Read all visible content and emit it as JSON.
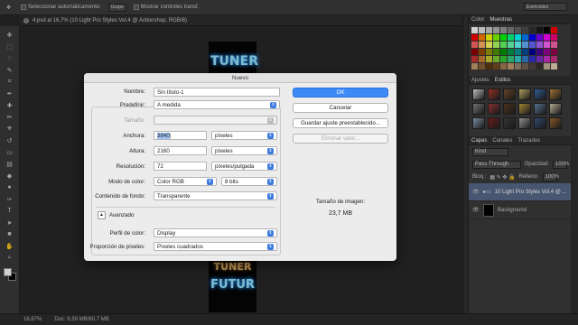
{
  "options_bar": {
    "auto_select_label": "Seleccionar automáticamente:",
    "auto_select_value": "Grupo",
    "transform_label": "Mostrar controles transf.",
    "workspace": "Esenciales"
  },
  "document_tab": {
    "title": "4.psd al 16,7% (10 Light Pro Styles Vol.4 @ Actionshop, RGB/8)"
  },
  "artwork": {
    "top_text": "TUNER",
    "bottom_top_text": "TUNER",
    "bottom_text": "FUTUR"
  },
  "status_bar": {
    "zoom": "16,67%",
    "doc_size": "Doc: 6,59 MB/60,7 MB"
  },
  "panels": {
    "color_tabs": [
      "Color",
      "Muestras"
    ],
    "style_tabs": [
      "Ajustes",
      "Estilos"
    ],
    "layer_tabs": [
      "Capas",
      "Canales",
      "Trazados"
    ],
    "kind_filter": "Kind",
    "blend_mode": "Pass Through",
    "opacity_label": "Opacidad:",
    "opacity_value": "100%",
    "lock_label": "Bloq.:",
    "fill_label": "Relleno:",
    "fill_value": "100%",
    "layers": [
      {
        "name": "10 Light Pro Styles Vol.4 @ ...",
        "selected": true
      },
      {
        "name": "Background",
        "selected": false
      }
    ],
    "swatch_colors": [
      "#ffffff",
      "#e6e6e6",
      "#cccccc",
      "#b3b3b3",
      "#999999",
      "#808080",
      "#666666",
      "#4d4d4d",
      "#333333",
      "#1a1a1a",
      "#000000",
      "#ff0000",
      "#ff0000",
      "#ff8000",
      "#ffff00",
      "#80ff00",
      "#00ff00",
      "#00ff80",
      "#00ffff",
      "#0080ff",
      "#0000ff",
      "#8000ff",
      "#ff00ff",
      "#ff0080",
      "#ff6666",
      "#ffb366",
      "#ffff66",
      "#b3ff66",
      "#66ff66",
      "#66ffb3",
      "#66ffff",
      "#66b3ff",
      "#6666ff",
      "#b366ff",
      "#ff66ff",
      "#ff66b3",
      "#990000",
      "#994d00",
      "#999900",
      "#4d9900",
      "#009900",
      "#00994d",
      "#009999",
      "#004d99",
      "#000099",
      "#4d0099",
      "#990099",
      "#99004d",
      "#cc3333",
      "#cc8033",
      "#cccc33",
      "#80cc33",
      "#33cc33",
      "#33cc80",
      "#33cccc",
      "#3380cc",
      "#3333cc",
      "#8033cc",
      "#cc33cc",
      "#cc3380",
      "#c49a6c",
      "#8c6239",
      "#603913",
      "#754c24",
      "#a67c52",
      "#c69c6d",
      "#998675",
      "#736357",
      "#534741",
      "#362f2d",
      "#c7b299",
      "#e6d2b5"
    ],
    "style_colors": [
      "#e8e8e8",
      "#b33a2a",
      "#7a5230",
      "#d4c070",
      "#3a6fb0",
      "#c08a40",
      "#8a8a8a",
      "#a03a3a",
      "#5a3a20",
      "#c8a040",
      "#6a8ab0",
      "#d8d0b0",
      "#90a8c0",
      "#802020",
      "#404040",
      "#b0b0b0",
      "#3a5a8a",
      "#a06a30"
    ]
  },
  "tools": [
    "move",
    "marquee",
    "lasso",
    "quick-select",
    "crop",
    "eyedropper",
    "healing",
    "brush",
    "stamp",
    "history-brush",
    "eraser",
    "gradient",
    "blur",
    "dodge",
    "pen",
    "type",
    "path-select",
    "shape",
    "hand",
    "zoom"
  ],
  "dialog": {
    "title": "Nuevo",
    "name_label": "Nombre:",
    "name_value": "Sin título-1",
    "preset_label": "Predefinir:",
    "preset_value": "A medida",
    "size_label": "Tamaño:",
    "width_label": "Anchura:",
    "width_value": "3840",
    "width_unit": "píxeles",
    "height_label": "Altura:",
    "height_value": "2160",
    "height_unit": "píxeles",
    "resolution_label": "Resolución:",
    "resolution_value": "72",
    "resolution_unit": "píxeles/pulgada",
    "color_mode_label": "Modo de color:",
    "color_mode_value": "Color RGB",
    "bit_depth": "8 bits",
    "background_label": "Contenido de fondo:",
    "background_value": "Transparente",
    "advanced_label": "Avanzado",
    "profile_label": "Perfil de color:",
    "profile_value": "Display",
    "pixel_aspect_label": "Proporción de píxeles:",
    "pixel_aspect_value": "Píxeles cuadrados",
    "ok_label": "OK",
    "cancel_label": "Cancelar",
    "save_preset_label": "Guardar ajuste preestablecido...",
    "delete_preset_label": "Eliminar valor...",
    "image_size_label": "Tamaño de imagen:",
    "image_size_value": "23,7 MB"
  }
}
